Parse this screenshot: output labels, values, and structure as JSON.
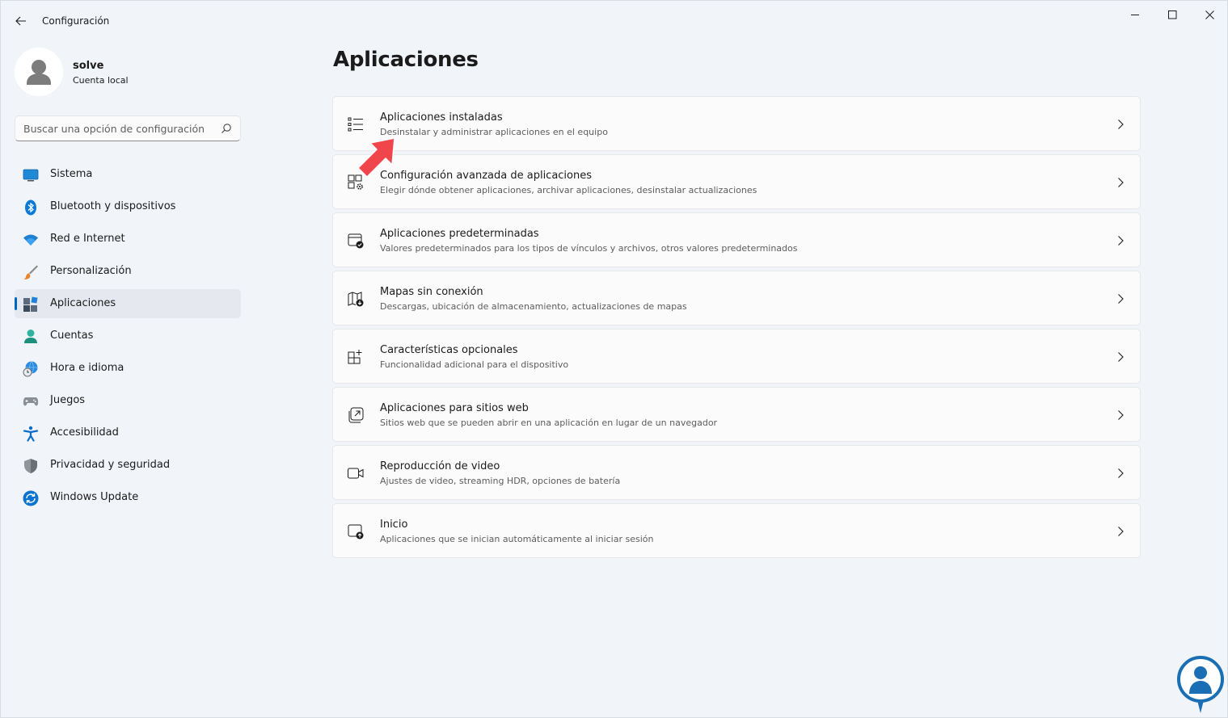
{
  "window": {
    "title": "Configuración",
    "icons": {
      "back": "back-arrow-icon",
      "minimize": "minimize-icon",
      "maximize": "maximize-icon",
      "close": "close-icon"
    }
  },
  "profile": {
    "name": "solve",
    "account_type": "Cuenta local"
  },
  "search": {
    "placeholder": "Buscar una opción de configuración",
    "value": ""
  },
  "sidebar": {
    "items": [
      {
        "label": "Sistema",
        "icon": "monitor-icon",
        "active": false
      },
      {
        "label": "Bluetooth y dispositivos",
        "icon": "bluetooth-icon",
        "active": false
      },
      {
        "label": "Red e Internet",
        "icon": "wifi-icon",
        "active": false
      },
      {
        "label": "Personalización",
        "icon": "paintbrush-icon",
        "active": false
      },
      {
        "label": "Aplicaciones",
        "icon": "apps-icon",
        "active": true
      },
      {
        "label": "Cuentas",
        "icon": "person-icon",
        "active": false
      },
      {
        "label": "Hora e idioma",
        "icon": "globe-clock-icon",
        "active": false
      },
      {
        "label": "Juegos",
        "icon": "gamepad-icon",
        "active": false
      },
      {
        "label": "Accesibilidad",
        "icon": "accessibility-icon",
        "active": false
      },
      {
        "label": "Privacidad y seguridad",
        "icon": "shield-icon",
        "active": false
      },
      {
        "label": "Windows Update",
        "icon": "update-icon",
        "active": false
      }
    ]
  },
  "main": {
    "title": "Aplicaciones",
    "cards": [
      {
        "title": "Aplicaciones instaladas",
        "description": "Desinstalar y administrar aplicaciones en el equipo",
        "icon": "list-icon"
      },
      {
        "title": "Configuración avanzada de aplicaciones",
        "description": "Elegir dónde obtener aplicaciones, archivar aplicaciones, desinstalar actualizaciones",
        "icon": "apps-gear-icon"
      },
      {
        "title": "Aplicaciones predeterminadas",
        "description": "Valores predeterminados para los tipos de vínculos y archivos, otros valores predeterminados",
        "icon": "default-apps-icon"
      },
      {
        "title": "Mapas sin conexión",
        "description": "Descargas, ubicación de almacenamiento, actualizaciones de mapas",
        "icon": "map-download-icon"
      },
      {
        "title": "Características opcionales",
        "description": "Funcionalidad adicional para el dispositivo",
        "icon": "grid-plus-icon"
      },
      {
        "title": "Aplicaciones para sitios web",
        "description": "Sitios web que se pueden abrir en una aplicación en lugar de un navegador",
        "icon": "open-external-icon"
      },
      {
        "title": "Reproducción de video",
        "description": "Ajustes de video, streaming HDR, opciones de batería",
        "icon": "video-camera-icon"
      },
      {
        "title": "Inicio",
        "description": "Aplicaciones que se inician automáticamente al iniciar sesión",
        "icon": "startup-icon"
      }
    ]
  },
  "colors": {
    "accent": "#0067c0",
    "annotation_arrow": "#f0454b",
    "logo_blue": "#1a6fb4"
  }
}
